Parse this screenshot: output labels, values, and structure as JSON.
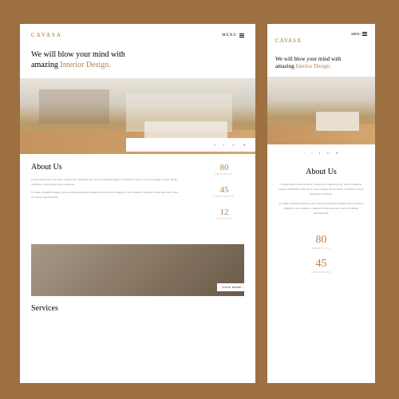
{
  "brand": "CAVASA",
  "menu_label": "MENU",
  "hero": {
    "line1": "We will blow your mind with",
    "line2_pre": "amazing ",
    "line2_accent": "Interior Design."
  },
  "social": {
    "f": "f",
    "t": "t",
    "i": "☉",
    "x": "✕"
  },
  "about": {
    "title": "About Us",
    "p1": "Lorem ipsum dolor sit amet, consectetur adipiscing elit. Sed do eiusmod tempor incididunt ut labore et dolore magna aliqua. Risus commodo viverra maecenas accumsan.",
    "p2": "Ut enim ad minim veniam, quis nostrud exercitation ullamco laboris nisi ut aliquip ex ea commodo consequat. Duis aute irure dolor accumsan reprehenderit."
  },
  "stats": [
    {
      "num": "80",
      "label": "PROJECTS"
    },
    {
      "num": "45",
      "label": "COUNTRIES"
    },
    {
      "num": "12",
      "label": "CLIENTS"
    }
  ],
  "view_more": "VIEW MORE  ›",
  "services_title": "Services",
  "nav_arrows": {
    "l": "‹",
    "r": "›"
  }
}
